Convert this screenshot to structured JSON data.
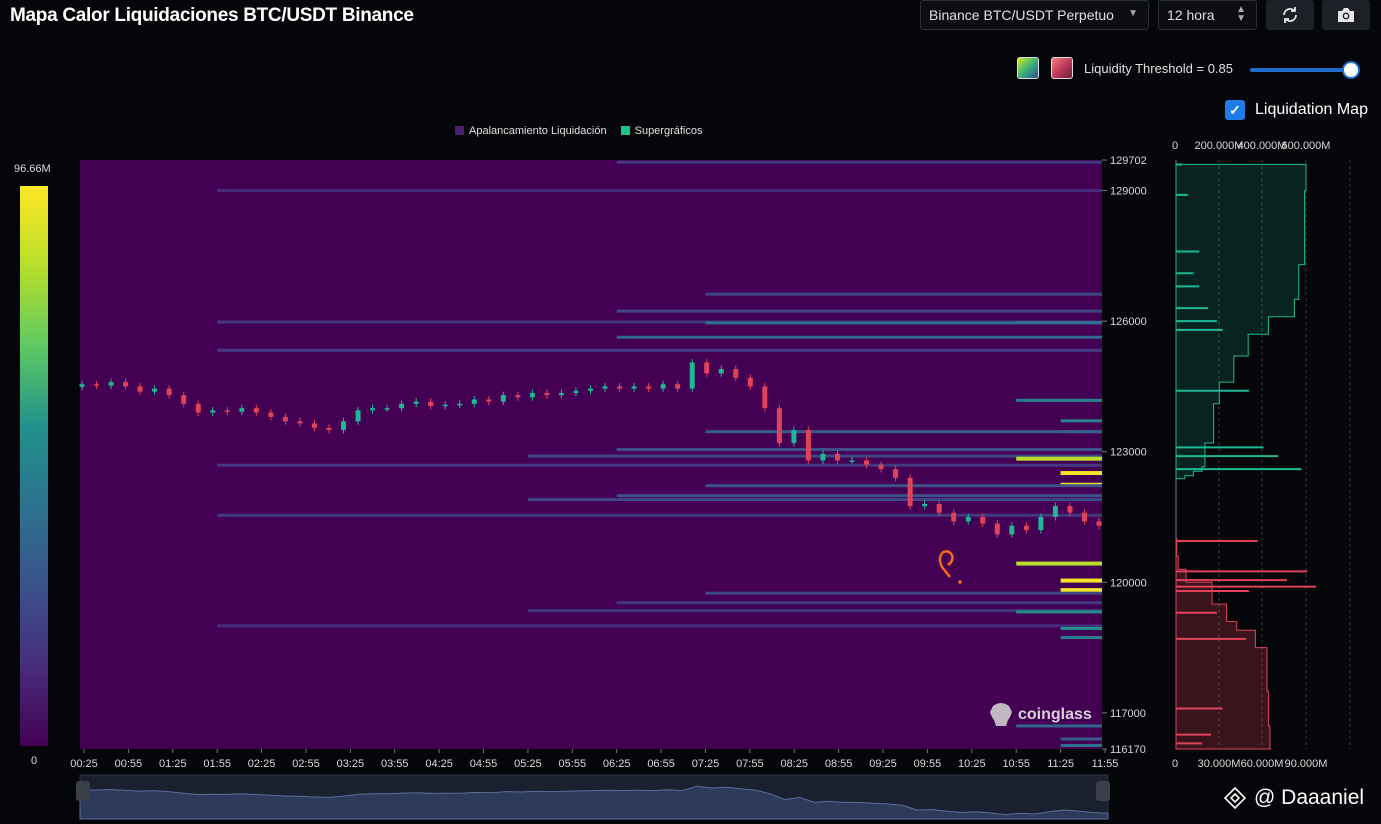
{
  "title": "Mapa Calor Liquidaciones BTC/USDT Binance",
  "controls": {
    "exchange": "Binance BTC/USDT Perpetuo",
    "interval": "12 hora",
    "threshold_label": "Liquidity Threshold = 0.85",
    "threshold_value": 0.85,
    "liquidation_map_label": "Liquidation Map",
    "liquidation_map_checked": true
  },
  "colorbar": {
    "max": "96.66M",
    "min": "0"
  },
  "watermark": "coinglass",
  "footer": "@ Daaaniel",
  "annotation": "?",
  "colors": {
    "background": "#440154",
    "long_side": "#1fb896",
    "short_side": "#e0425a",
    "accent": "#1e7be8"
  },
  "icons": {
    "dropdown": "chevron-down-icon",
    "interval": "up-down-icon",
    "refresh": "refresh-icon",
    "camera": "camera-icon",
    "check": "check-icon",
    "logo": "coinglass-logo-icon",
    "footer": "binance-logo-icon"
  },
  "chart_data": [
    {
      "type": "heatmap",
      "legend": [
        "Apalancamiento Liquidación",
        "Supergráficos"
      ],
      "x_ticks": [
        "00:25",
        "00:55",
        "01:25",
        "01:55",
        "02:25",
        "02:55",
        "03:25",
        "03:55",
        "04:25",
        "04:55",
        "05:25",
        "05:55",
        "06:25",
        "06:55",
        "07:25",
        "07:55",
        "08:25",
        "08:55",
        "09:25",
        "09:55",
        "10:25",
        "10:55",
        "11:25",
        "11:55"
      ],
      "y_ticks": [
        "129702",
        "129000",
        "126000",
        "123000",
        "120000",
        "117000",
        "116170"
      ],
      "ylim": [
        116170,
        129702
      ],
      "price_close": [
        124550,
        124520,
        124600,
        124500,
        124380,
        124450,
        124300,
        124100,
        123900,
        123950,
        123920,
        124000,
        123900,
        123800,
        123700,
        123650,
        123550,
        123500,
        123700,
        123950,
        124000,
        124000,
        124100,
        124150,
        124050,
        124080,
        124100,
        124200,
        124150,
        124300,
        124250,
        124350,
        124300,
        124350,
        124400,
        124450,
        124500,
        124450,
        124500,
        124450,
        124550,
        124450,
        125050,
        124800,
        124900,
        124700,
        124500,
        124000,
        123200,
        123500,
        122800,
        122950,
        122800,
        122800,
        122700,
        122600,
        122400,
        121750,
        121800,
        121600,
        121400,
        121500,
        121350,
        121100,
        121300,
        121200,
        121500,
        121750,
        121600,
        121400,
        121300
      ],
      "liquidity_bands": [
        {
          "price": 129650,
          "start": "06:25",
          "end": "11:55",
          "level": 0.2
        },
        {
          "price": 129000,
          "start": "01:55",
          "end": "11:55",
          "level": 0.15
        },
        {
          "price": 126620,
          "start": "07:25",
          "end": "11:55",
          "level": 0.25
        },
        {
          "price": 126230,
          "start": "06:25",
          "end": "11:55",
          "level": 0.25
        },
        {
          "price": 125980,
          "start": "01:55",
          "end": "11:55",
          "level": 0.2
        },
        {
          "price": 125970,
          "start": "10:55",
          "end": "11:55",
          "level": 0.3
        },
        {
          "price": 125960,
          "start": "07:25",
          "end": "11:55",
          "level": 0.45
        },
        {
          "price": 125630,
          "start": "06:25",
          "end": "11:55",
          "level": 0.4
        },
        {
          "price": 125330,
          "start": "01:55",
          "end": "11:55",
          "level": 0.2
        },
        {
          "price": 124180,
          "start": "10:55",
          "end": "11:55",
          "level": 0.5
        },
        {
          "price": 123710,
          "start": "11:25",
          "end": "11:55",
          "level": 0.5
        },
        {
          "price": 123460,
          "start": "11:25",
          "end": "11:55",
          "level": 0.5
        },
        {
          "price": 123460,
          "start": "07:25",
          "end": "08:25",
          "level": 0.35
        },
        {
          "price": 123050,
          "start": "06:25",
          "end": "08:55",
          "level": 0.3
        },
        {
          "price": 122900,
          "start": "05:25",
          "end": "11:55",
          "level": 0.25
        },
        {
          "price": 122840,
          "start": "10:55",
          "end": "11:55",
          "level": 0.85
        },
        {
          "price": 122690,
          "start": "01:55",
          "end": "11:55",
          "level": 0.2
        },
        {
          "price": 122510,
          "start": "11:25",
          "end": "11:55",
          "level": 0.98
        },
        {
          "price": 122240,
          "start": "11:25",
          "end": "11:55",
          "level": 0.98
        },
        {
          "price": 122220,
          "start": "07:25",
          "end": "09:55",
          "level": 0.3
        },
        {
          "price": 121990,
          "start": "06:25",
          "end": "11:55",
          "level": 0.3
        },
        {
          "price": 121900,
          "start": "05:25",
          "end": "11:55",
          "level": 0.25
        },
        {
          "price": 121540,
          "start": "01:55",
          "end": "11:55",
          "level": 0.2
        },
        {
          "price": 120430,
          "start": "10:55",
          "end": "11:55",
          "level": 0.85
        },
        {
          "price": 120040,
          "start": "11:25",
          "end": "11:55",
          "level": 0.98
        },
        {
          "price": 119820,
          "start": "11:25",
          "end": "11:55",
          "level": 0.98
        },
        {
          "price": 119750,
          "start": "07:25",
          "end": "11:55",
          "level": 0.25
        },
        {
          "price": 119530,
          "start": "06:25",
          "end": "11:55",
          "level": 0.2
        },
        {
          "price": 119350,
          "start": "05:25",
          "end": "11:55",
          "level": 0.2
        },
        {
          "price": 119320,
          "start": "10:55",
          "end": "11:55",
          "level": 0.55
        },
        {
          "price": 119000,
          "start": "01:55",
          "end": "11:55",
          "level": 0.15
        },
        {
          "price": 118940,
          "start": "11:25",
          "end": "11:55",
          "level": 0.55
        },
        {
          "price": 118730,
          "start": "11:25",
          "end": "11:55",
          "level": 0.5
        },
        {
          "price": 116700,
          "start": "10:55",
          "end": "11:55",
          "level": 0.4
        },
        {
          "price": 116400,
          "start": "11:25",
          "end": "11:55",
          "level": 0.35
        },
        {
          "price": 116250,
          "start": "11:25",
          "end": "11:55",
          "level": 0.45
        }
      ]
    },
    {
      "type": "area",
      "name": "liquidation-map",
      "top_axis_ticks": [
        "0",
        "200.000M",
        "400.000M",
        "600.000M"
      ],
      "bottom_axis_ticks": [
        "0",
        "30.000M",
        "60.000M",
        "90.000M"
      ],
      "cumulative_short": [
        [
          129600,
          90
        ],
        [
          129000,
          89
        ],
        [
          127300,
          85
        ],
        [
          126500,
          82
        ],
        [
          126100,
          64
        ],
        [
          125700,
          50
        ],
        [
          125200,
          40
        ],
        [
          124600,
          30
        ],
        [
          124100,
          26
        ],
        [
          123200,
          20
        ],
        [
          122650,
          18
        ],
        [
          122550,
          12
        ],
        [
          122450,
          6
        ],
        [
          122380,
          1
        ]
      ],
      "cumulative_long": [
        [
          121000,
          0.5
        ],
        [
          120600,
          1.5
        ],
        [
          120300,
          7
        ],
        [
          120000,
          25
        ],
        [
          119500,
          35
        ],
        [
          119100,
          42
        ],
        [
          118900,
          55
        ],
        [
          118500,
          63
        ],
        [
          117500,
          64
        ],
        [
          116700,
          65
        ],
        [
          116170,
          66
        ]
      ],
      "spikes_short": [
        [
          129600,
          2
        ],
        [
          128900,
          4
        ],
        [
          127600,
          8
        ],
        [
          127100,
          6
        ],
        [
          126800,
          8
        ],
        [
          126300,
          11
        ],
        [
          126000,
          14
        ],
        [
          125800,
          16
        ],
        [
          124400,
          25
        ],
        [
          123100,
          30
        ],
        [
          122900,
          35
        ],
        [
          122600,
          43
        ]
      ],
      "spikes_long": [
        [
          120950,
          28
        ],
        [
          120250,
          45
        ],
        [
          120050,
          38
        ],
        [
          119900,
          48
        ],
        [
          119800,
          25
        ],
        [
          119300,
          14
        ],
        [
          118700,
          24
        ],
        [
          117100,
          16
        ],
        [
          116500,
          12
        ],
        [
          116300,
          9
        ]
      ]
    }
  ]
}
